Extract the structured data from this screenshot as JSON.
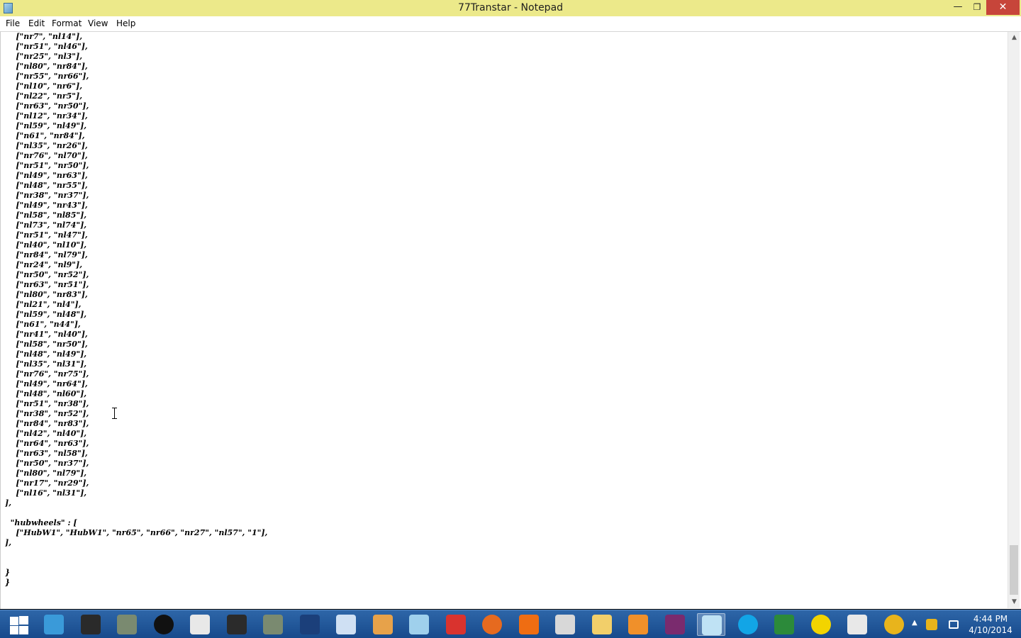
{
  "window": {
    "title": "77Transtar - Notepad",
    "minimize_symbol": "—",
    "restore_symbol": "❐",
    "close_symbol": "✕"
  },
  "menu": {
    "items": [
      "File",
      "Edit",
      "Format",
      "View",
      "Help"
    ]
  },
  "editor": {
    "lines": [
      "    [\"nr7\", \"nl14\"],",
      "    [\"nr51\", \"nl46\"],",
      "    [\"nr25\", \"nl3\"],",
      "    [\"nl80\", \"nr84\"],",
      "    [\"nr55\", \"nr66\"],",
      "    [\"nl10\", \"nr6\"],",
      "    [\"nl22\", \"nr5\"],",
      "    [\"nr63\", \"nr50\"],",
      "    [\"nl12\", \"nr34\"],",
      "    [\"nl59\", \"nl49\"],",
      "    [\"n61\", \"nr84\"],",
      "    [\"nl35\", \"nr26\"],",
      "    [\"nr76\", \"nl70\"],",
      "    [\"nr51\", \"nr50\"],",
      "    [\"nl49\", \"nr63\"],",
      "    [\"nl48\", \"nr55\"],",
      "    [\"nr38\", \"nr37\"],",
      "    [\"nl49\", \"nr43\"],",
      "    [\"nl58\", \"nl85\"],",
      "    [\"nl73\", \"nl74\"],",
      "    [\"nr51\", \"nl47\"],",
      "    [\"nl40\", \"nl10\"],",
      "    [\"nr84\", \"nl79\"],",
      "    [\"nr24\", \"nl9\"],",
      "    [\"nr50\", \"nr52\"],",
      "    [\"nr63\", \"nr51\"],",
      "    [\"nl80\", \"nr83\"],",
      "    [\"nl21\", \"nl4\"],",
      "    [\"nl59\", \"nl48\"],",
      "    [\"n61\", \"n44\"],",
      "    [\"nr41\", \"nl40\"],",
      "    [\"nl58\", \"nr50\"],",
      "    [\"nl48\", \"nl49\"],",
      "    [\"nl35\", \"nl31\"],",
      "    [\"nr76\", \"nr75\"],",
      "    [\"nl49\", \"nr64\"],",
      "    [\"nl48\", \"nl60\"],",
      "    [\"nr51\", \"nr38\"],",
      "    [\"nr38\", \"nr52\"],",
      "    [\"nr84\", \"nr83\"],",
      "    [\"nl42\", \"nl40\"],",
      "    [\"nr64\", \"nr63\"],",
      "    [\"nr63\", \"nl58\"],",
      "    [\"nr50\", \"nr37\"],",
      "    [\"nl80\", \"nl79\"],",
      "    [\"nr17\", \"nr29\"],",
      "    [\"nl16\", \"nl31\"],",
      "],",
      "",
      "  \"hubwheels\" : [",
      "    [\"HubW1\", \"HubW1\", \"nr65\", \"nr66\", \"nr27\", \"nl57\", \"1\"],",
      "],",
      "",
      "",
      "}",
      "}"
    ]
  },
  "scrollbar": {
    "up_symbol": "▲",
    "down_symbol": "▼"
  },
  "taskbar": {
    "icons": [
      {
        "name": "internet-explorer-icon",
        "color": "#3a9ad9"
      },
      {
        "name": "puzzle-app-icon",
        "color": "#2a2a2a"
      },
      {
        "name": "truck-game-icon",
        "color": "#7a8a70"
      },
      {
        "name": "record-icon",
        "color": "#111111"
      },
      {
        "name": "pen-tool-icon",
        "color": "#e8e8e8"
      },
      {
        "name": "video-editor-icon",
        "color": "#2b2b2b"
      },
      {
        "name": "truck-game-2-icon",
        "color": "#7a8a70"
      },
      {
        "name": "windows-media-icon",
        "color": "#1b3f7a"
      },
      {
        "name": "control-panel-icon",
        "color": "#cfe0f3"
      },
      {
        "name": "paint-app-icon",
        "color": "#e7a24a"
      },
      {
        "name": "notepad-icon",
        "color": "#9fd0ec"
      },
      {
        "name": "sketchup-icon",
        "color": "#d9332e"
      },
      {
        "name": "firefox-icon",
        "color": "#e66a1f"
      },
      {
        "name": "molecule-app-icon",
        "color": "#ef6d12"
      },
      {
        "name": "truck-app-icon",
        "color": "#d8d8d8"
      },
      {
        "name": "file-explorer-icon",
        "color": "#f2cf6a"
      },
      {
        "name": "blender-icon",
        "color": "#f0902a"
      },
      {
        "name": "winrar-icon",
        "color": "#7a2b6e"
      },
      {
        "name": "notepad-active-icon",
        "color": "#bfe2f4"
      },
      {
        "name": "skype-icon",
        "color": "#12a5e6"
      },
      {
        "name": "car-game-icon",
        "color": "#2c8a3a"
      },
      {
        "name": "ring-app-icon",
        "color": "#f2d400"
      },
      {
        "name": "document-window-icon",
        "color": "#e8e8e8"
      },
      {
        "name": "chrome-icon",
        "color": "#e8b41c"
      }
    ],
    "clock_time": "4:44 PM",
    "clock_date": "4/10/2014"
  }
}
